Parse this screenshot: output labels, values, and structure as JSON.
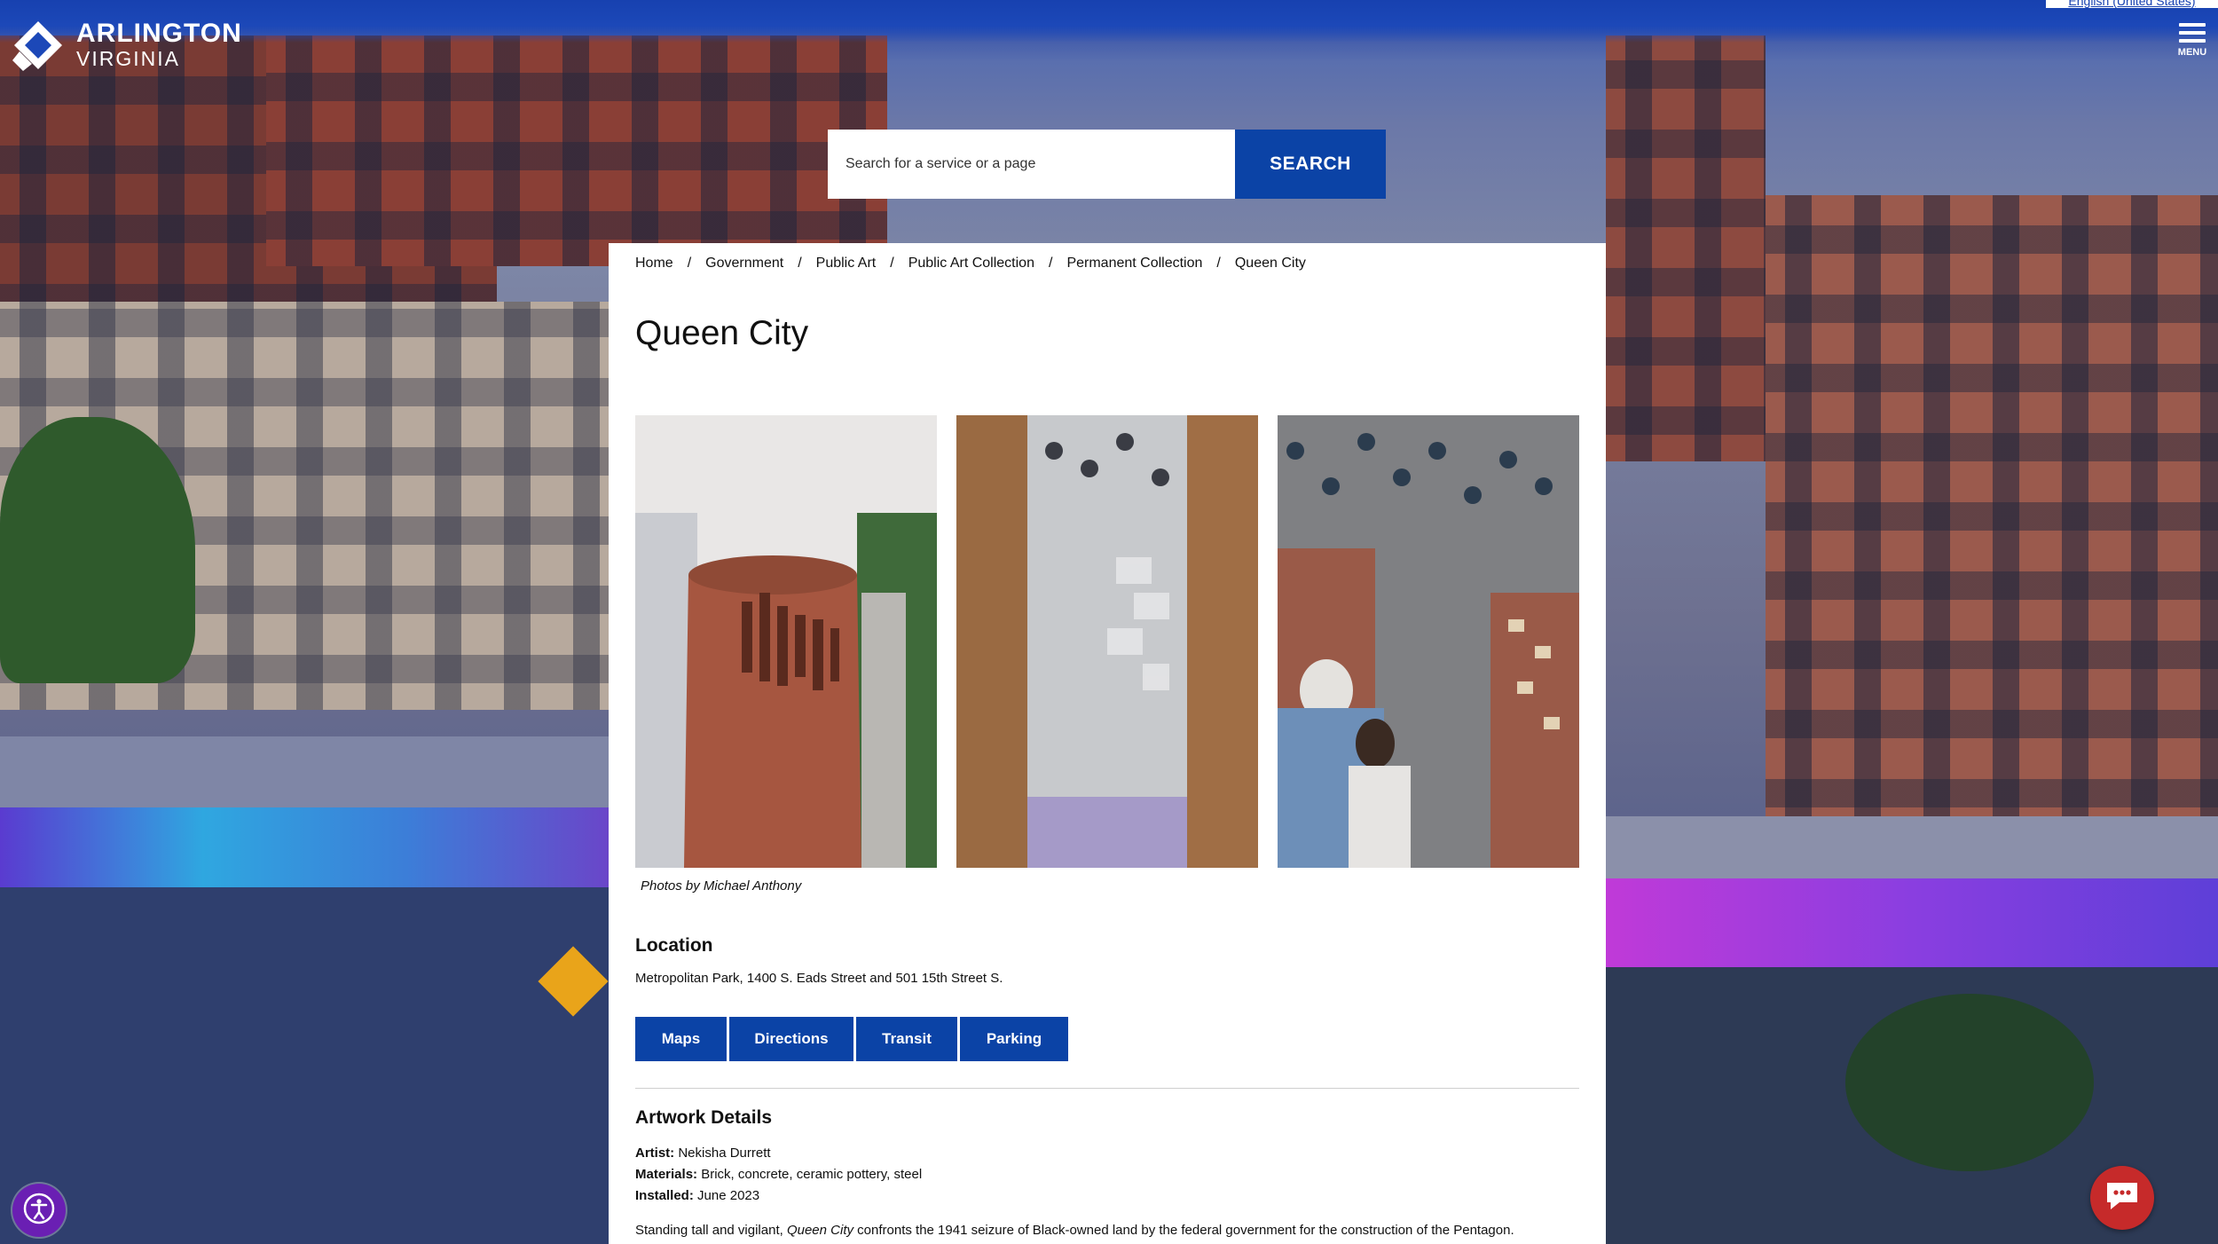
{
  "header": {
    "logo_line1": "ARLINGTON",
    "logo_line2": "VIRGINIA",
    "language": "English (United States)",
    "menu_label": "MENU"
  },
  "search": {
    "placeholder": "Search for a service or a page",
    "button_label": "SEARCH"
  },
  "breadcrumb": [
    "Home",
    "Government",
    "Public Art",
    "Public Art Collection",
    "Permanent Collection",
    "Queen City"
  ],
  "page_title": "Queen City",
  "gallery": {
    "photos": [
      "brick-tower-photo",
      "wood-glass-panel-photo",
      "visitors-looking-up-photo"
    ],
    "caption": "Photos by Michael Anthony"
  },
  "location": {
    "heading": "Location",
    "address": "Metropolitan Park, 1400 S. Eads Street and 501 15th Street S.",
    "buttons": [
      "Maps",
      "Directions",
      "Transit",
      "Parking"
    ]
  },
  "artwork": {
    "heading": "Artwork Details",
    "artist_label": "Artist:",
    "artist": "Nekisha Durrett",
    "materials_label": "Materials:",
    "materials": "Brick, concrete, ceramic pottery, steel",
    "installed_label": "Installed:",
    "installed": "June 2023",
    "desc_prefix": "Standing tall and vigilant,",
    "desc_title": "Queen City",
    "desc_suffix": "confronts the 1941 seizure of Black-owned land by the federal government for the construction of the Pentagon."
  },
  "colors": {
    "brand_blue": "#0b43a6",
    "accessibility": "#6a1fb3",
    "chat": "#c62a2a"
  }
}
